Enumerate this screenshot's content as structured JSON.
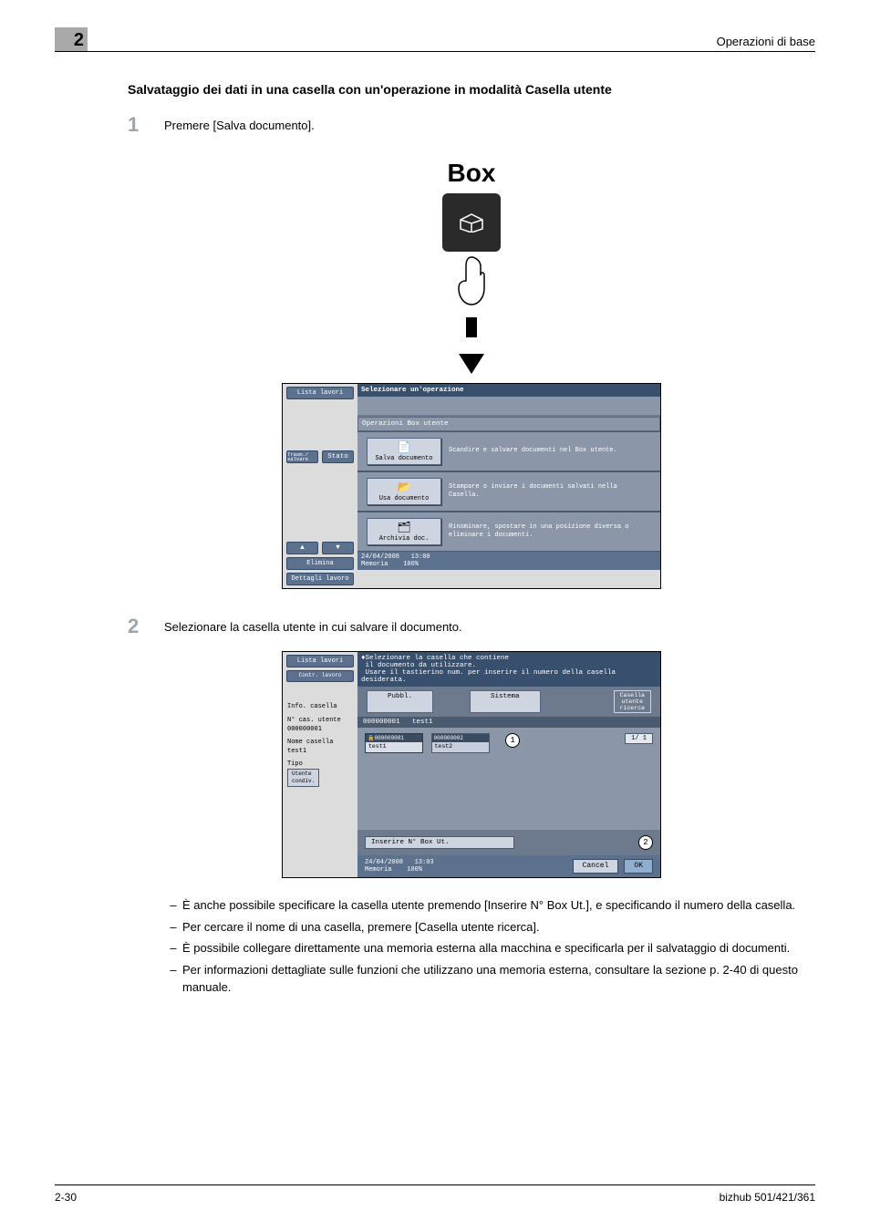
{
  "header": {
    "right": "Operazioni di base",
    "chapter": "2"
  },
  "section_title": "Salvataggio dei dati in una casella con un'operazione in modalità Casella utente",
  "steps": {
    "s1_num": "1",
    "s1_text": "Premere [Salva documento].",
    "s2_num": "2",
    "s2_text": "Selezionare la casella utente in cui salvare il documento."
  },
  "box_figure": {
    "label": "Box"
  },
  "screen1": {
    "job_list": "Lista lavori",
    "title": "Selezionare un'operazione",
    "subheader": "Operazioni Box utente",
    "side_tab_left": "Trasm./\nsalvare",
    "side_tab_right": "Stato",
    "ops": {
      "save": {
        "btn": "Salva documento",
        "desc": "Scandire e salvare documenti nel Box utente."
      },
      "use": {
        "btn": "Usa documento",
        "desc": "Stampare o inviare i documenti salvati nella Casella."
      },
      "file": {
        "btn": "Archivia doc.",
        "desc": "Rinominare, spostare in una posizione diversa o eliminare i documenti."
      }
    },
    "side_delete": "Elimina",
    "side_details": "Dettagli lavoro",
    "status_date": "24/04/2008",
    "status_time": "13:00",
    "status_mem_label": "Memoria",
    "status_mem_val": "100%"
  },
  "screen2": {
    "job_list": "Lista lavori",
    "job_contr": "Contr.\nlavoro",
    "title1": "Selezionare la casella che contiene",
    "title2": "il documento da utilizzare.",
    "title3": "Usare il tastierino num. per inserire il numero della casella desiderata.",
    "tab_public": "Pubbl.",
    "tab_system": "Sistema",
    "search_label": "Casella\nutente ricerca",
    "list_header_num": "000000001",
    "list_header_name": "test1",
    "left_info": {
      "info_title": "Info. casella",
      "box_num_label": "N° cas. utente",
      "box_num_val": "000000001",
      "box_name_label": "Nome casella",
      "box_name_val": "test1",
      "type_label": "Tipo",
      "type_val": "Utente\ncondiv."
    },
    "cards": [
      {
        "num": "000000001",
        "name": "test1",
        "selected": true
      },
      {
        "num": "000000002",
        "name": "test2",
        "selected": false
      }
    ],
    "callout1": "1",
    "page_indicator": "1/  1",
    "input_label": "Inserire N° Box Ut.",
    "callout2": "2",
    "cancel": "Cancel",
    "ok": "OK",
    "status_date": "24/04/2008",
    "status_time": "13:03",
    "status_mem_label": "Memoria",
    "status_mem_val": "100%"
  },
  "bullets": {
    "b1": "È anche possibile specificare la casella utente premendo [Inserire N° Box Ut.], e specificando il numero della casella.",
    "b2": "Per cercare il nome di una casella, premere [Casella utente ricerca].",
    "b3": "È possibile collegare direttamente una memoria esterna alla macchina e specificarla per il salvataggio di documenti.",
    "b4": "Per informazioni dettagliate sulle funzioni che utilizzano una memoria esterna, consultare la sezione p. 2-40 di questo manuale."
  },
  "footer": {
    "page": "2-30",
    "model": "bizhub 501/421/361"
  }
}
